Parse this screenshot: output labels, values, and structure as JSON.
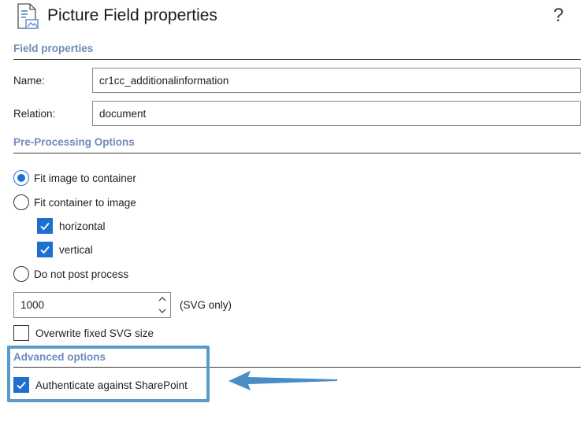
{
  "dialog": {
    "title": "Picture Field properties",
    "help_label": "?"
  },
  "field_properties": {
    "header": "Field properties",
    "name_label": "Name:",
    "name_value": "cr1cc_additionalinformation",
    "relation_label": "Relation:",
    "relation_value": "document"
  },
  "pre_processing": {
    "header": "Pre-Processing Options",
    "fit_image_label": "Fit image to container",
    "fit_image_checked": true,
    "fit_container_label": "Fit container to image",
    "fit_container_checked": false,
    "horizontal_label": "horizontal",
    "horizontal_checked": true,
    "vertical_label": "vertical",
    "vertical_checked": true,
    "no_post_label": "Do not post process",
    "no_post_checked": false,
    "size_value": "1000",
    "size_suffix": "(SVG only)",
    "overwrite_label": "Overwrite fixed SVG size",
    "overwrite_checked": false
  },
  "advanced": {
    "header": "Advanced options",
    "authenticate_label": "Authenticate against SharePoint",
    "authenticate_checked": true
  },
  "colors": {
    "accent": "#1e6fd0",
    "section_header": "#6f8bb8",
    "highlight": "#5b9bc9"
  }
}
